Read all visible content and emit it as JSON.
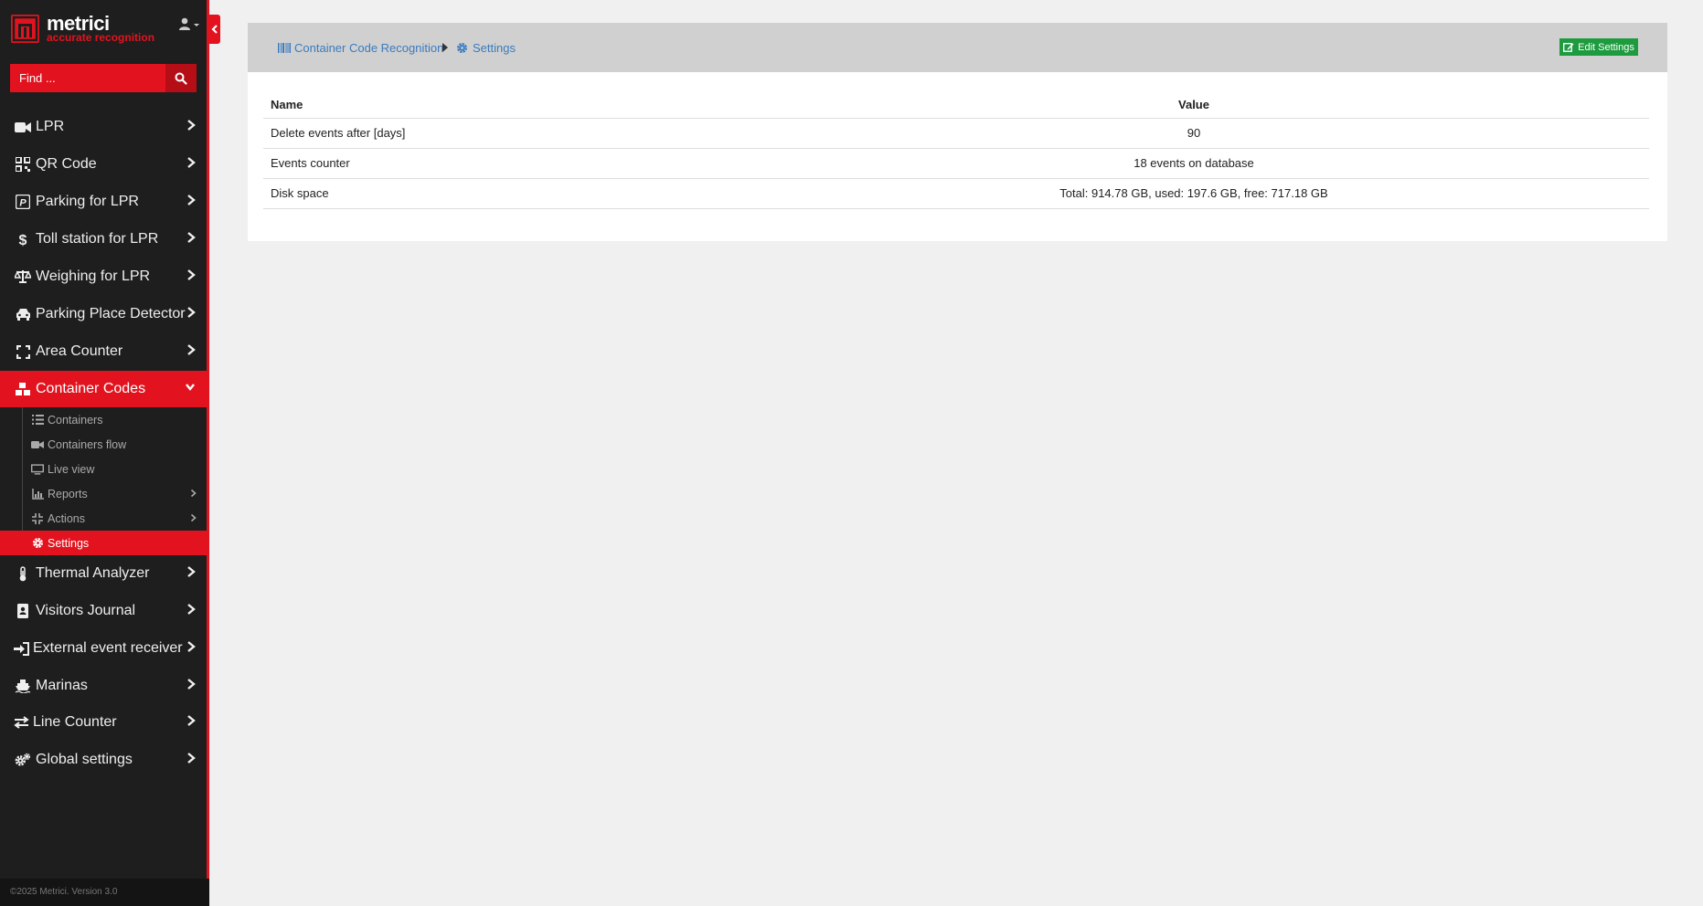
{
  "brand": {
    "name": "metrici",
    "tagline": "accurate recognition",
    "accent": "#e2131f"
  },
  "search": {
    "placeholder": "Find ..."
  },
  "sidebar": {
    "items": [
      {
        "label": "LPR",
        "icon": "video-camera-icon"
      },
      {
        "label": "QR Code",
        "icon": "qr-code-icon"
      },
      {
        "label": "Parking for LPR",
        "icon": "parking-icon"
      },
      {
        "label": "Toll station for LPR",
        "icon": "dollar-icon"
      },
      {
        "label": "Weighing for LPR",
        "icon": "scale-icon"
      },
      {
        "label": "Parking Place Detector",
        "icon": "car-icon"
      },
      {
        "label": "Area Counter",
        "icon": "expand-icon"
      },
      {
        "label": "Container Codes",
        "icon": "boxes-icon",
        "expanded": true
      },
      {
        "label": "Thermal Analyzer",
        "icon": "thermometer-icon"
      },
      {
        "label": "Visitors Journal",
        "icon": "id-badge-icon"
      },
      {
        "label": "External event receiver",
        "icon": "sign-in-icon"
      },
      {
        "label": "Marinas",
        "icon": "ship-icon"
      },
      {
        "label": "Line Counter",
        "icon": "exchange-icon"
      },
      {
        "label": "Global settings",
        "icon": "cogs-icon"
      }
    ],
    "sub_items": [
      {
        "label": "Containers",
        "icon": "list-icon"
      },
      {
        "label": "Containers flow",
        "icon": "video-camera-icon"
      },
      {
        "label": "Live view",
        "icon": "monitor-icon"
      },
      {
        "label": "Reports",
        "icon": "chart-icon"
      },
      {
        "label": "Actions",
        "icon": "compress-icon"
      },
      {
        "label": "Settings",
        "icon": "gear-icon",
        "active": true
      }
    ]
  },
  "footer": {
    "copyright": "©2025 Metrici. Version 3.0"
  },
  "breadcrumb": {
    "items": [
      {
        "label": "Container Code Recognition",
        "icon": "barcode-icon"
      },
      {
        "label": "Settings",
        "icon": "gear-icon"
      }
    ]
  },
  "toolbar": {
    "edit_label": "Edit Settings",
    "edit_color": "#1e9b3f"
  },
  "table": {
    "headers": [
      "Name",
      "Value"
    ],
    "rows": [
      [
        "Delete events after [days]",
        "90"
      ],
      [
        "Events counter",
        "18 events on database"
      ],
      [
        "Disk space",
        "Total: 914.78 GB, used: 197.6 GB, free: 717.18 GB"
      ]
    ]
  }
}
